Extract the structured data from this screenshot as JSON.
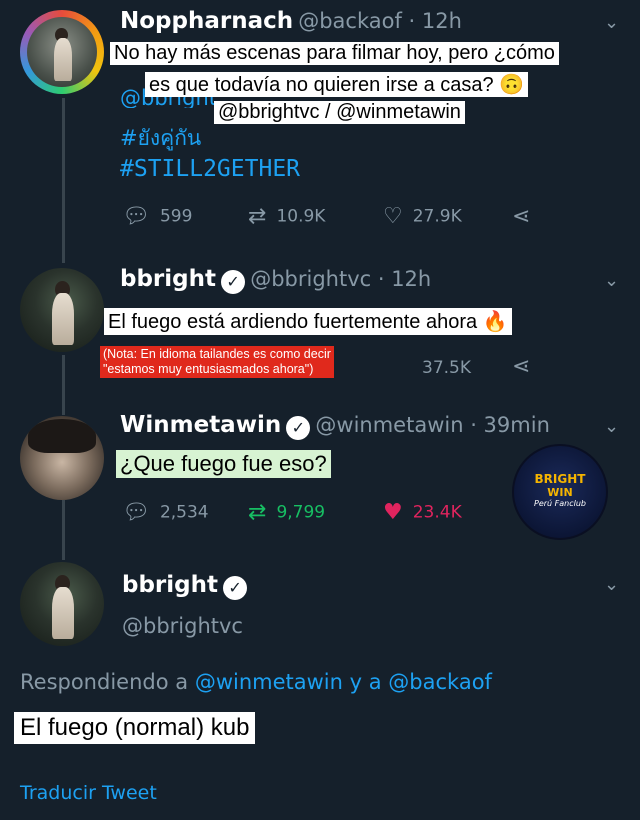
{
  "tweets": [
    {
      "name": "Noppharnach",
      "handle": "@backaof · 12h",
      "mention_partial": "@bbright",
      "hashtags": [
        "#ยังคู่กัน",
        "#STILL2GETHER"
      ],
      "caption_line1": "No hay más escenas para filmar hoy, pero ¿cómo",
      "caption_line2": "es que todavía no quieren irse a casa? 🙃",
      "caption_line3": "@bbrightvc / @winmetawin",
      "stats": {
        "replies": "599",
        "retweets": "10.9K",
        "likes": "27.9K"
      }
    },
    {
      "name": "bbright",
      "handle": "@bbrightvc · 12h",
      "caption": "El fuego está ardiendo fuertemente ahora 🔥",
      "note_line1": "(Nota: En idioma tailandes es como decir",
      "note_line2": "\"estamos muy entusiasmados ahora\")",
      "stats": {
        "likes": "37.5K"
      }
    },
    {
      "name": "Winmetawin",
      "handle": "@winmetawin · 39min",
      "caption": "¿Que fuego fue eso?",
      "stats": {
        "replies": "2,534",
        "retweets": "9,799",
        "likes": "23.4K"
      }
    }
  ],
  "main_tweet": {
    "name": "bbright",
    "handle": "@bbrightvc",
    "replying_prefix": "Respondiendo a",
    "replying_user1": "@winmetawin",
    "replying_conj": "y a",
    "replying_user2": "@backaof",
    "caption": "El fuego (normal) kub",
    "translate": "Traducir Tweet"
  },
  "badge": {
    "line1": "BRIGHT",
    "line2": "WIN",
    "line3": "Perú Fanclub"
  },
  "icons": {
    "reply": "reply-icon",
    "retweet": "retweet-icon",
    "like": "heart-icon",
    "share": "share-icon",
    "verified": "verified-badge-icon",
    "chevron": "chevron-down-icon"
  },
  "colors": {
    "background": "#15202b",
    "link": "#1da1f2",
    "retweet_active": "#17bf63",
    "like_active": "#e0245e",
    "muted": "#8899a6"
  }
}
